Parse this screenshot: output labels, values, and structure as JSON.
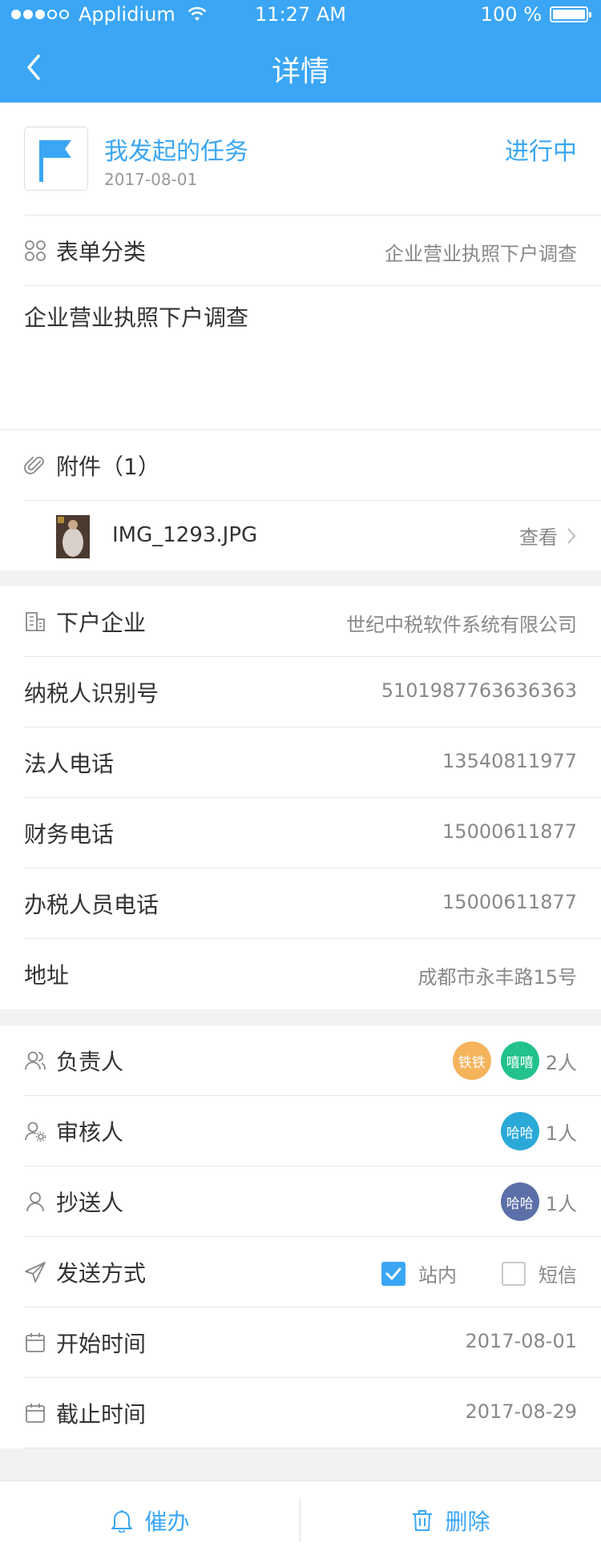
{
  "status_bar": {
    "carrier": "Applidium",
    "time": "11:27 AM",
    "battery": "100 %"
  },
  "nav": {
    "title": "详情"
  },
  "task": {
    "title": "我发起的任务",
    "date": "2017-08-01",
    "status": "进行中"
  },
  "form": {
    "category_label": "表单分类",
    "category_value": "企业营业执照下户调查",
    "description": "企业营业执照下户调查",
    "attachments_label": "附件（1）",
    "file_name": "IMG_1293.JPG",
    "view_label": "查看"
  },
  "company": {
    "enterprise_label": "下户企业",
    "enterprise_value": "世纪中税软件系统有限公司",
    "tax_id_label": "纳税人识别号",
    "tax_id_value": "5101987763636363",
    "legal_phone_label": "法人电话",
    "legal_phone_value": "13540811977",
    "finance_phone_label": "财务电话",
    "finance_phone_value": "15000611877",
    "tax_staff_phone_label": "办税人员电话",
    "tax_staff_phone_value": "15000611877",
    "address_label": "地址",
    "address_value": "成都市永丰路15号"
  },
  "people": {
    "owner_label": "负责人",
    "owner_avatars": [
      "铁铁",
      "嘻嘻"
    ],
    "owner_count": "2人",
    "reviewer_label": "审核人",
    "reviewer_avatars": [
      "哈哈"
    ],
    "reviewer_count": "1人",
    "cc_label": "抄送人",
    "cc_avatars": [
      "哈哈"
    ],
    "cc_count": "1人"
  },
  "send": {
    "label": "发送方式",
    "option_internal": "站内",
    "option_internal_checked": true,
    "option_sms": "短信",
    "option_sms_checked": false
  },
  "dates": {
    "start_label": "开始时间",
    "start_value": "2017-08-01",
    "end_label": "截止时间",
    "end_value": "2017-08-29"
  },
  "footer": {
    "urge_label": "催办",
    "delete_label": "删除"
  },
  "colors": {
    "accent": "#3aa6f5",
    "avatar_tietie": "#f5b35b",
    "avatar_xixi": "#22c28a",
    "avatar_haha_reviewer": "#2aa9d8",
    "avatar_haha_cc": "#5c6fa8"
  }
}
